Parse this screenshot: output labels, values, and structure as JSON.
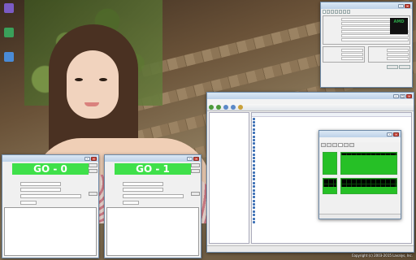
{
  "desktop": {
    "icons": [
      {
        "label": "",
        "color": "#7b5bc4"
      },
      {
        "label": "",
        "color": "#3aa05a"
      },
      {
        "label": "",
        "color": "#4a8bd6"
      }
    ],
    "copyright": "Copyright (c) 2003-2015 Lavalys, Inc."
  },
  "cpuz": {
    "title": "",
    "tabs": [
      "",
      "",
      "",
      "",
      "",
      "",
      ""
    ],
    "logo": "AMD",
    "rows": [
      {
        "label": "",
        "value": ""
      },
      {
        "label": "",
        "value": ""
      },
      {
        "label": "",
        "value": ""
      },
      {
        "label": "",
        "value": ""
      },
      {
        "label": "",
        "value": ""
      },
      {
        "label": "",
        "value": ""
      }
    ],
    "clock_rows": [
      {
        "label": "",
        "value": ""
      },
      {
        "label": "",
        "value": ""
      },
      {
        "label": "",
        "value": ""
      }
    ],
    "cache_rows": [
      {
        "label": "",
        "value": ""
      },
      {
        "label": "",
        "value": ""
      },
      {
        "label": "",
        "value": ""
      }
    ],
    "footer_version": "",
    "footer_buttons": [
      "",
      ""
    ]
  },
  "go_windows": [
    {
      "title": "",
      "banner": "GO - 0",
      "side_buttons": [
        "",
        "",
        ""
      ],
      "fields": {
        "duration": "",
        "mode": "",
        "range": "",
        "accept": ""
      },
      "labels": {
        "duration": "",
        "mode": "",
        "range": "",
        "accept": "",
        "left_check": "",
        "right_check": ""
      },
      "log_lines": [
        "",
        "",
        "",
        "",
        "",
        "",
        "",
        "",
        "",
        ""
      ]
    },
    {
      "title": "",
      "banner": "GO - 1",
      "side_buttons": [
        "",
        "",
        ""
      ],
      "fields": {
        "duration": "",
        "mode": "",
        "range": "",
        "accept": ""
      },
      "labels": {
        "duration": "",
        "mode": "",
        "range": "",
        "accept": "",
        "left_check": "",
        "right_check": ""
      },
      "log_lines": [
        "",
        "",
        "",
        "",
        "",
        "",
        "",
        "",
        "",
        ""
      ]
    }
  ],
  "aida": {
    "title": "",
    "menu": [
      "",
      "",
      "",
      "",
      ""
    ],
    "toolbar_label": "",
    "tree": [
      "",
      "",
      "",
      "",
      "",
      "",
      "",
      "",
      "",
      "",
      "",
      "",
      "",
      "",
      "",
      "",
      "",
      "",
      "",
      "",
      "",
      "",
      "",
      "",
      ""
    ],
    "list_header": [
      "",
      ""
    ],
    "list": [
      {
        "k": "",
        "v": ""
      },
      {
        "k": "",
        "v": ""
      },
      {
        "k": "",
        "v": ""
      },
      {
        "k": "",
        "v": ""
      },
      {
        "k": "",
        "v": ""
      },
      {
        "k": "",
        "v": ""
      },
      {
        "k": "",
        "v": ""
      },
      {
        "k": "",
        "v": ""
      },
      {
        "k": "",
        "v": ""
      },
      {
        "k": "",
        "v": ""
      },
      {
        "k": "",
        "v": ""
      },
      {
        "k": "",
        "v": ""
      },
      {
        "k": "",
        "v": ""
      },
      {
        "k": "",
        "v": ""
      },
      {
        "k": "",
        "v": ""
      },
      {
        "k": "",
        "v": ""
      },
      {
        "k": "",
        "v": ""
      },
      {
        "k": "",
        "v": ""
      },
      {
        "k": "",
        "v": ""
      },
      {
        "k": "",
        "v": ""
      },
      {
        "k": "",
        "v": ""
      },
      {
        "k": "",
        "v": ""
      },
      {
        "k": "",
        "v": ""
      },
      {
        "k": "",
        "v": ""
      },
      {
        "k": "",
        "v": ""
      },
      {
        "k": "",
        "v": ""
      },
      {
        "k": "",
        "v": ""
      },
      {
        "k": "",
        "v": ""
      },
      {
        "k": "",
        "v": ""
      },
      {
        "k": "",
        "v": ""
      }
    ],
    "status": ""
  },
  "taskmgr": {
    "title": "",
    "menu": [
      "",
      "",
      ""
    ],
    "tabs": [
      "",
      "",
      "",
      "",
      "",
      ""
    ],
    "graphs": [
      {
        "label": "",
        "level": 1.0
      },
      {
        "label": "",
        "level": 0.42
      }
    ],
    "stats_left": [
      "",
      "",
      "",
      "",
      "",
      ""
    ],
    "stats_right": [
      "",
      "",
      "",
      "",
      "",
      ""
    ],
    "status": ""
  }
}
